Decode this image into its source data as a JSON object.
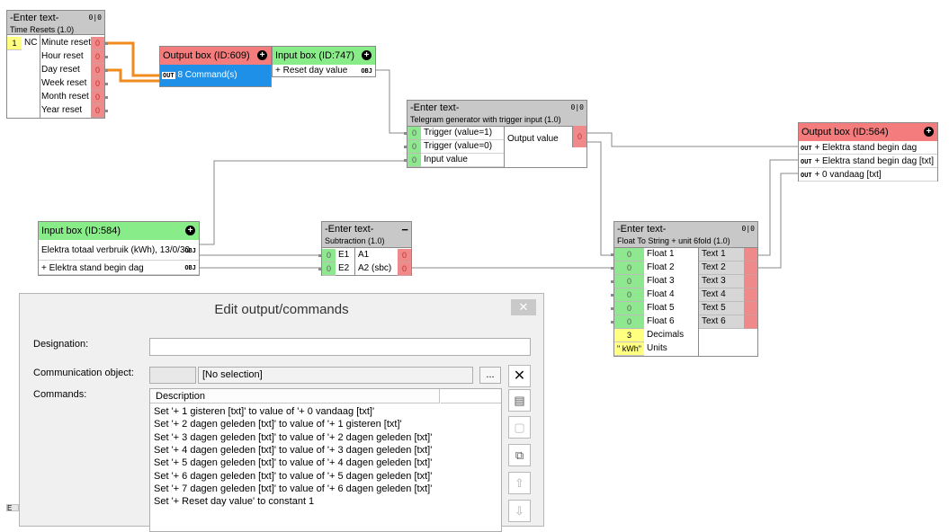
{
  "time_resets": {
    "title": "-Enter text-",
    "subtitle": "Time Resets (1.0)",
    "badge": "0|0",
    "in_value": "1",
    "in_label": "NC",
    "outputs": [
      {
        "label": "Minute reset",
        "value": "0"
      },
      {
        "label": "Hour reset",
        "value": "0"
      },
      {
        "label": "Day reset",
        "value": "0"
      },
      {
        "label": "Week reset",
        "value": "0"
      },
      {
        "label": "Month reset",
        "value": "0"
      },
      {
        "label": "Year reset",
        "value": "0"
      }
    ]
  },
  "output_609": {
    "title": "Output box (ID:609)",
    "tag": "OUT",
    "command": "8 Command(s)"
  },
  "input_747": {
    "title": "Input box (ID:747)",
    "label": "+ Reset day value",
    "obj": "OBJ"
  },
  "telegram": {
    "title": "-Enter text-",
    "subtitle": "Telegram generator with trigger input (1.0)",
    "badge": "0|0",
    "inputs": [
      {
        "label": "Trigger (value=1)",
        "value": "0"
      },
      {
        "label": "Trigger (value=0)",
        "value": "0"
      },
      {
        "label": "Input value",
        "value": "0"
      }
    ],
    "output_label": "Output value",
    "output_value": "0"
  },
  "output_564": {
    "title": "Output box (ID:564)",
    "tag": "OUT",
    "rows": [
      "+ Elektra stand begin dag",
      "+ Elektra stand begin dag [txt]",
      "+ 0 vandaag [txt]"
    ]
  },
  "input_584": {
    "title": "Input box (ID:584)",
    "obj": "OBJ",
    "rows": [
      "Elektra totaal verbruik (kWh), 13/0/30",
      "+ Elektra stand begin dag"
    ]
  },
  "subtraction": {
    "title": "-Enter text-",
    "subtitle": "Subtraction (1.0)",
    "inputs": [
      {
        "label": "E1",
        "value": "0"
      },
      {
        "label": "E2",
        "value": "0"
      }
    ],
    "outputs": [
      {
        "label": "A1",
        "value": "0"
      },
      {
        "label": "A2 (sbc)",
        "value": "0"
      }
    ]
  },
  "float_to_string": {
    "title": "-Enter text-",
    "subtitle": "Float To String + unit 6fold (1.0)",
    "badge": "0|0",
    "inputs": [
      {
        "label": "Float 1",
        "value": "0"
      },
      {
        "label": "Float 2",
        "value": "0"
      },
      {
        "label": "Float 3",
        "value": "0"
      },
      {
        "label": "Float 4",
        "value": "0"
      },
      {
        "label": "Float 5",
        "value": "0"
      },
      {
        "label": "Float 6",
        "value": "0"
      }
    ],
    "outputs": [
      "Text 1",
      "Text 2",
      "Text 3",
      "Text 4",
      "Text 5",
      "Text 6"
    ],
    "decimals_label": "Decimals",
    "decimals_value": "3",
    "units_label": "Units",
    "units_value": "\" kWh\""
  },
  "dialog": {
    "title": "Edit output/commands",
    "close": "✕",
    "designation_label": "Designation:",
    "designation_value": "",
    "comm_label": "Communication object:",
    "comm_value": "[No selection]",
    "browse": "...",
    "commands_label": "Commands:",
    "col_description": "Description",
    "commands": [
      "Set '+ 1 gisteren [txt]' to value of '+ 0 vandaag [txt]'",
      "Set '+ 2 dagen geleden [txt]' to value of '+ 1 gisteren [txt]'",
      "Set '+ 3 dagen geleden [txt]' to value of '+ 2 dagen geleden [txt]'",
      "Set '+ 4 dagen geleden [txt]' to value of '+ 3 dagen geleden [txt]'",
      "Set '+ 5 dagen geleden [txt]' to value of '+ 4 dagen geleden [txt]'",
      "Set '+ 6 dagen geleden [txt]' to value of '+ 5 dagen geleden [txt]'",
      "Set '+ 7 dagen geleden [txt]' to value of '+ 6 dagen geleden [txt]'",
      "Set '+ Reset day value' to constant 1"
    ],
    "bottom_left_char": "E"
  },
  "colors": {
    "wire": "#8a8a8a",
    "wire_active": "#f08a1c",
    "pin_green": "#8fe88f",
    "pin_red": "#f08a8a",
    "header_red": "#f47c7c",
    "header_green": "#88ec88",
    "selected_blue": "#1e90e8"
  }
}
